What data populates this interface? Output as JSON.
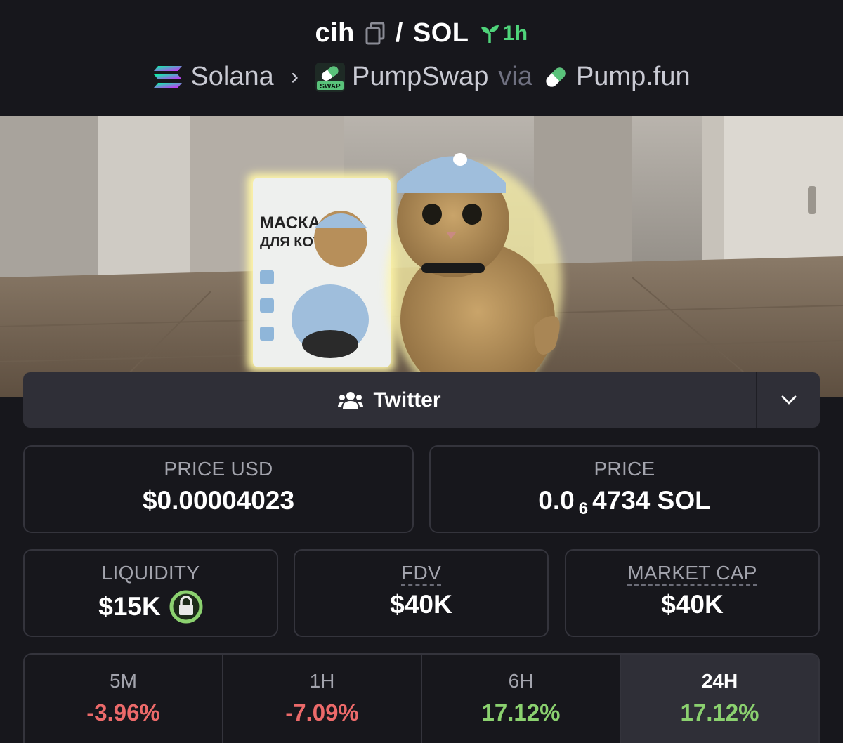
{
  "header": {
    "token_symbol": "cih",
    "pair_separator": "/",
    "quote_symbol": "SOL",
    "age": "1h",
    "chain": "Solana",
    "dex": "PumpSwap",
    "dex_badge_text": "SWAP",
    "via": "via",
    "launchpad": "Pump.fun"
  },
  "banner": {
    "package_title_line1": "МАСКА",
    "package_title_line2": "ДЛЯ КОТА"
  },
  "socials": {
    "label": "Twitter"
  },
  "stats": {
    "price_usd_label": "PRICE USD",
    "price_usd_value": "$0.00004023",
    "price_label": "PRICE",
    "price_prefix": "0.0",
    "price_zero_count": "6",
    "price_suffix": "4734 SOL",
    "liquidity_label": "LIQUIDITY",
    "liquidity_value": "$15K",
    "fdv_label": "FDV",
    "fdv_value": "$40K",
    "mcap_label": "MARKET CAP",
    "mcap_value": "$40K"
  },
  "changes": [
    {
      "label": "5M",
      "value": "-3.96%"
    },
    {
      "label": "1H",
      "value": "-7.09%"
    },
    {
      "label": "6H",
      "value": "17.12%"
    },
    {
      "label": "24H",
      "value": "17.12%"
    }
  ],
  "colors": {
    "background": "#17171c",
    "card_border": "#34343c",
    "negative": "#ec6a6a",
    "positive": "#8bd16f",
    "age_green": "#4fd47a"
  }
}
